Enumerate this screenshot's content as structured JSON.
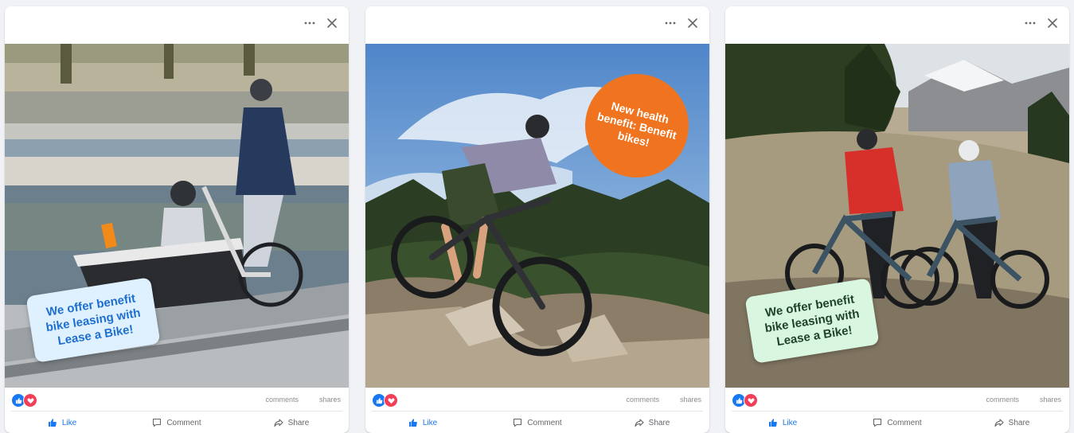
{
  "colors": {
    "like_blue": "#1877f2",
    "love_red": "#f33e58",
    "badge_orange": "#f0741f",
    "sticker_blue_bg": "#dff1ff",
    "sticker_green_bg": "#d9f6e0"
  },
  "icons": [
    "more-icon",
    "close-icon",
    "like-reaction-icon",
    "love-reaction-icon",
    "thumbs-up-icon",
    "comment-icon",
    "share-icon"
  ],
  "posts": [
    {
      "overlay_text": "We offer benefit bike leasing with Lease a Bike!",
      "counts": {
        "comments": "comments",
        "shares": "shares"
      },
      "actions": {
        "like": "Like",
        "comment": "Comment",
        "share": "Share"
      }
    },
    {
      "overlay_text": "New health benefit: Benefit bikes!",
      "counts": {
        "comments": "comments",
        "shares": "shares"
      },
      "actions": {
        "like": "Like",
        "comment": "Comment",
        "share": "Share"
      }
    },
    {
      "overlay_text": "We offer benefit bike leasing with Lease a Bike!",
      "counts": {
        "comments": "comments",
        "shares": "shares"
      },
      "actions": {
        "like": "Like",
        "comment": "Comment",
        "share": "Share"
      }
    }
  ]
}
